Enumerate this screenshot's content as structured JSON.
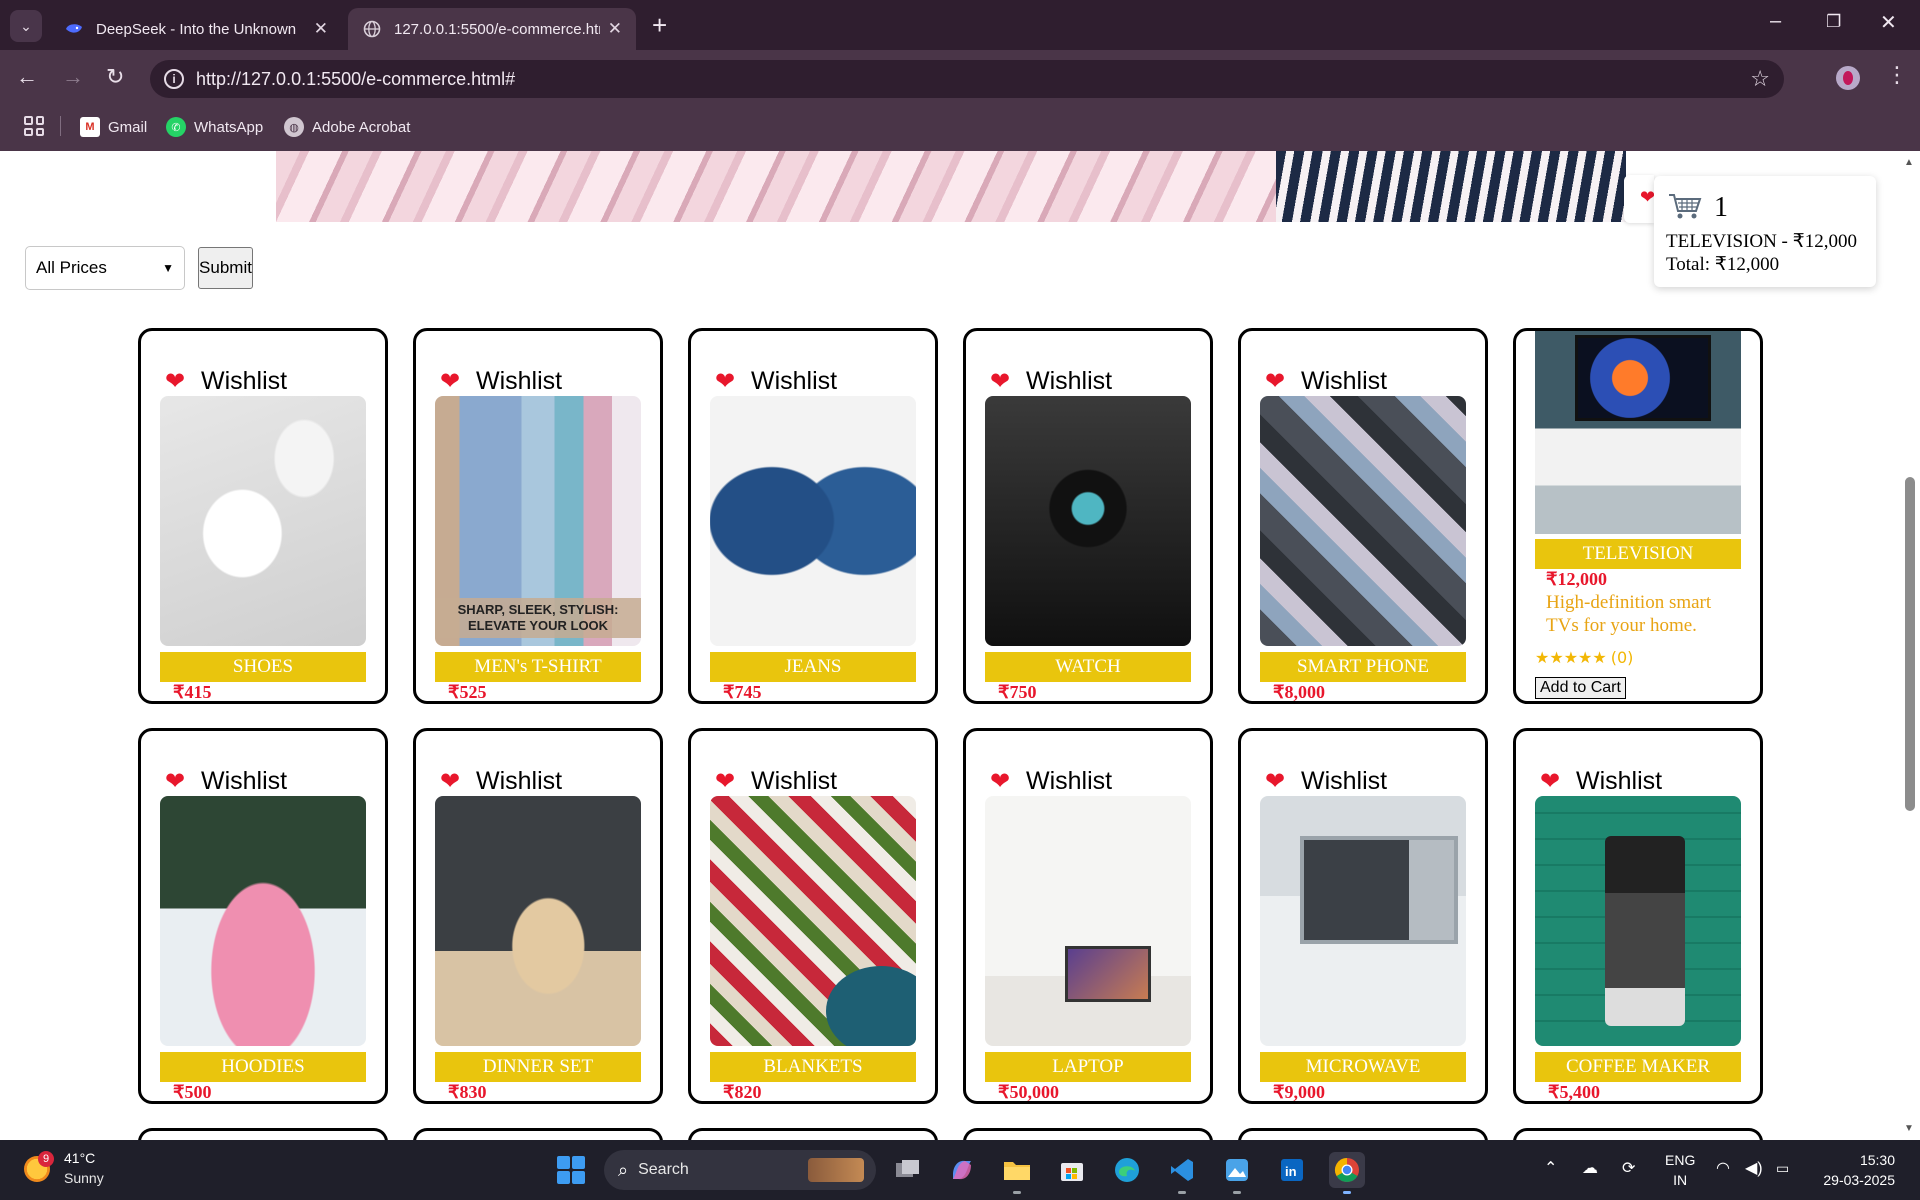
{
  "browser": {
    "tabs": [
      {
        "title": "DeepSeek - Into the Unknown",
        "active": false
      },
      {
        "title": "127.0.0.1:5500/e-commerce.htm",
        "active": true
      }
    ],
    "url": "http://127.0.0.1:5500/e-commerce.html#",
    "bookmarks": [
      {
        "label": "Gmail",
        "icon": "gmail-icon"
      },
      {
        "label": "WhatsApp",
        "icon": "whatsapp-icon"
      },
      {
        "label": "Adobe Acrobat",
        "icon": "globe-icon"
      }
    ]
  },
  "page": {
    "filter": {
      "selected": "All Prices"
    },
    "submit_label": "Submit",
    "cart": {
      "count": "1",
      "line": "TELEVISION - ₹12,000",
      "total": "Total: ₹12,000"
    },
    "wishlist_label": "Wishlist",
    "products": [
      {
        "name": "SHOES",
        "price": "₹415"
      },
      {
        "name": "MEN's T-SHIRT",
        "price": "₹525",
        "image_caption": "SHARP, SLEEK, STYLISH: ELEVATE YOUR LOOK"
      },
      {
        "name": "JEANS",
        "price": "₹745"
      },
      {
        "name": "WATCH",
        "price": "₹750"
      },
      {
        "name": "SMART PHONE",
        "price": "₹8,000"
      },
      {
        "name": "TELEVISION",
        "price": "₹12,000",
        "description": "High-definition smart TVs for your home.",
        "rating": "★★★★★",
        "rating_count": "(0)",
        "button": "Add to Cart"
      },
      {
        "name": "HOODIES",
        "price": "₹500"
      },
      {
        "name": "DINNER SET",
        "price": "₹830"
      },
      {
        "name": "BLANKETS",
        "price": "₹820"
      },
      {
        "name": "LAPTOP",
        "price": "₹50,000"
      },
      {
        "name": "MICROWAVE",
        "price": "₹9,000"
      },
      {
        "name": "COFFEE MAKER",
        "price": "₹5,400"
      }
    ]
  },
  "taskbar": {
    "weather": {
      "temp": "41°C",
      "condition": "Sunny",
      "badge": "9"
    },
    "search_label": "Search",
    "language": {
      "line1": "ENG",
      "line2": "IN"
    },
    "clock": {
      "time": "15:30",
      "date": "29-03-2025"
    }
  },
  "colors": {
    "accent_yellow": "#e9c50d",
    "price_red": "#e8172c",
    "desc_orange": "#e8a414",
    "chrome_dark": "#2f1e2f",
    "chrome_mid": "#4a3548"
  }
}
